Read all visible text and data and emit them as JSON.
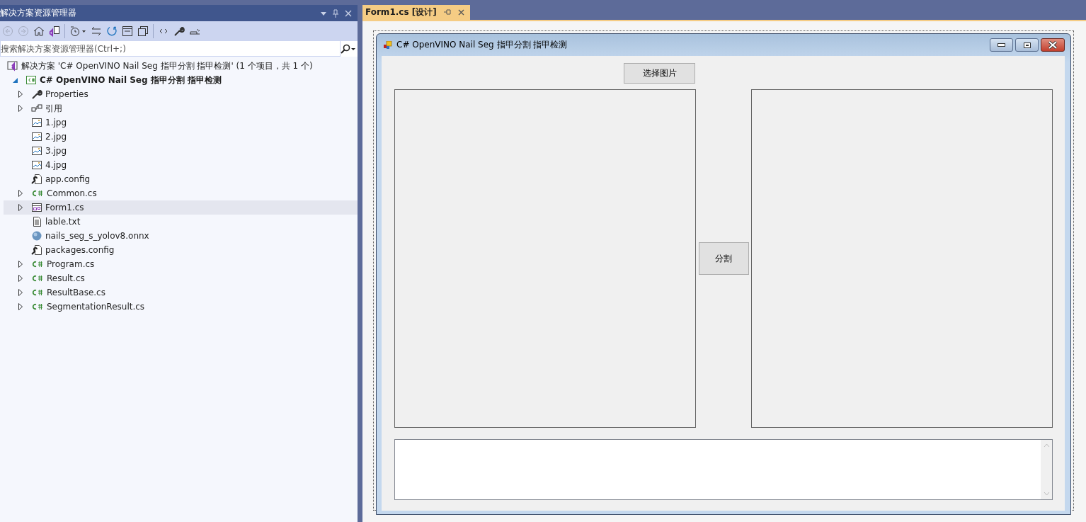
{
  "explorer": {
    "title": "解决方案资源管理器",
    "search": {
      "placeholder": "搜索解决方案资源管理器(Ctrl+;)"
    },
    "tree": [
      {
        "label": "解决方案 'C# OpenVINO Nail Seg 指甲分割  指甲检测' (1 个项目，共 1 个)",
        "kind": "solution",
        "has_children": false,
        "selected": false,
        "children": [
          {
            "label": "C# OpenVINO Nail Seg 指甲分割  指甲检测",
            "kind": "project",
            "has_children": true,
            "expanded": true,
            "selected": false,
            "children": [
              {
                "label": "Properties",
                "kind": "wrench",
                "has_children": true,
                "expanded": false,
                "selected": false
              },
              {
                "label": "引用",
                "kind": "references",
                "has_children": true,
                "expanded": false,
                "selected": false
              },
              {
                "label": "1.jpg",
                "kind": "image",
                "has_children": false,
                "selected": false
              },
              {
                "label": "2.jpg",
                "kind": "image",
                "has_children": false,
                "selected": false
              },
              {
                "label": "3.jpg",
                "kind": "image",
                "has_children": false,
                "selected": false
              },
              {
                "label": "4.jpg",
                "kind": "image",
                "has_children": false,
                "selected": false
              },
              {
                "label": "app.config",
                "kind": "config",
                "has_children": false,
                "selected": false
              },
              {
                "label": "Common.cs",
                "kind": "csharp",
                "has_children": true,
                "expanded": false,
                "selected": false
              },
              {
                "label": "Form1.cs",
                "kind": "form",
                "has_children": true,
                "expanded": false,
                "selected": true
              },
              {
                "label": "lable.txt",
                "kind": "text",
                "has_children": false,
                "selected": false
              },
              {
                "label": "nails_seg_s_yolov8.onnx",
                "kind": "model",
                "has_children": false,
                "selected": false
              },
              {
                "label": "packages.config",
                "kind": "config",
                "has_children": false,
                "selected": false
              },
              {
                "label": "Program.cs",
                "kind": "csharp",
                "has_children": true,
                "expanded": false,
                "selected": false
              },
              {
                "label": "Result.cs",
                "kind": "csharp",
                "has_children": true,
                "expanded": false,
                "selected": false
              },
              {
                "label": "ResultBase.cs",
                "kind": "csharp",
                "has_children": true,
                "expanded": false,
                "selected": false
              },
              {
                "label": "SegmentationResult.cs",
                "kind": "csharp",
                "has_children": true,
                "expanded": false,
                "selected": false
              }
            ]
          }
        ]
      }
    ]
  },
  "tabs": [
    {
      "label": "Form1.cs [设计]",
      "selected": true
    }
  ],
  "form": {
    "title": "C# OpenVINO Nail Seg 指甲分割  指甲检测",
    "buttons": [
      {
        "label": "选择图片"
      },
      {
        "label": "分割"
      }
    ]
  }
}
